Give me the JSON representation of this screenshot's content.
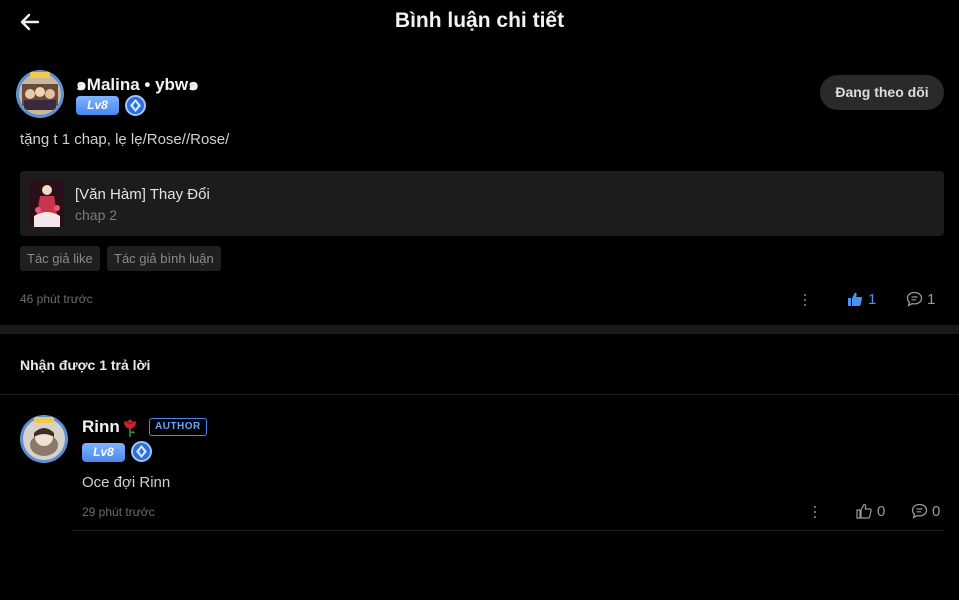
{
  "header": {
    "title": "Bình luận chi tiết"
  },
  "comment": {
    "username": "๑Malina • ybw๑",
    "level": "Lv8",
    "follow_label": "Đang theo dõi",
    "text": "tặng t 1 chap, lẹ lẹ/Rose//Rose/",
    "chapter": {
      "title": "[Văn Hàm] Thay Đổi",
      "subtitle": "chap 2"
    },
    "tags": [
      "Tác giả like",
      "Tác giả bình luận"
    ],
    "time": "46 phút trước",
    "likes": "1",
    "replies": "1",
    "liked": true
  },
  "replies_section": {
    "title": "Nhận được 1 trả lời"
  },
  "reply": {
    "username": "Rinn",
    "role_badge": "AUTHOR",
    "level": "Lv8",
    "text": "Oce đợi Rinn",
    "time": "29 phút trước",
    "likes": "0",
    "replies": "0",
    "liked": false
  },
  "colors": {
    "background": "#000000",
    "accent": "#4a86ee",
    "liked": "#4a90f0"
  }
}
